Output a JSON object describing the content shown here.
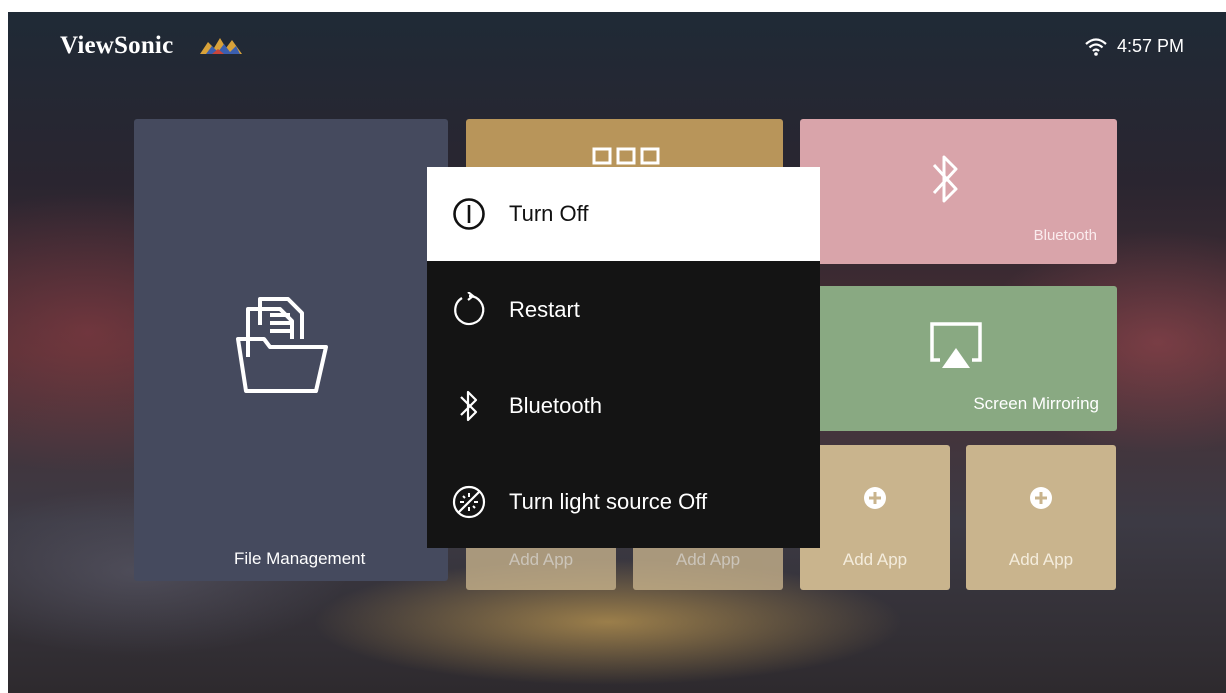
{
  "header": {
    "brand": "ViewSonic",
    "time": "4:57 PM",
    "wifi_icon": "wifi-icon"
  },
  "tiles": {
    "file_management": "File Management",
    "bluetooth": "Bluetooth",
    "screen_mirroring": "Screen Mirroring",
    "add_apps": [
      "Add App",
      "Add App",
      "Add App",
      "Add App"
    ]
  },
  "power_menu": {
    "items": [
      {
        "label": "Turn Off",
        "icon": "power-icon",
        "selected": true
      },
      {
        "label": "Restart",
        "icon": "restart-icon",
        "selected": false
      },
      {
        "label": "Bluetooth",
        "icon": "bluetooth-icon",
        "selected": false
      },
      {
        "label": "Turn light source Off",
        "icon": "light-source-off-icon",
        "selected": false
      }
    ]
  },
  "colors": {
    "file_tile": "#454a5e",
    "apps_tile": "#b8955a",
    "bluetooth_tile": "#d9a4aa",
    "mirroring_tile": "#89a982",
    "add_app_tile": "#c9b48d",
    "menu_bg": "#141414",
    "menu_selected": "#ffffff"
  }
}
